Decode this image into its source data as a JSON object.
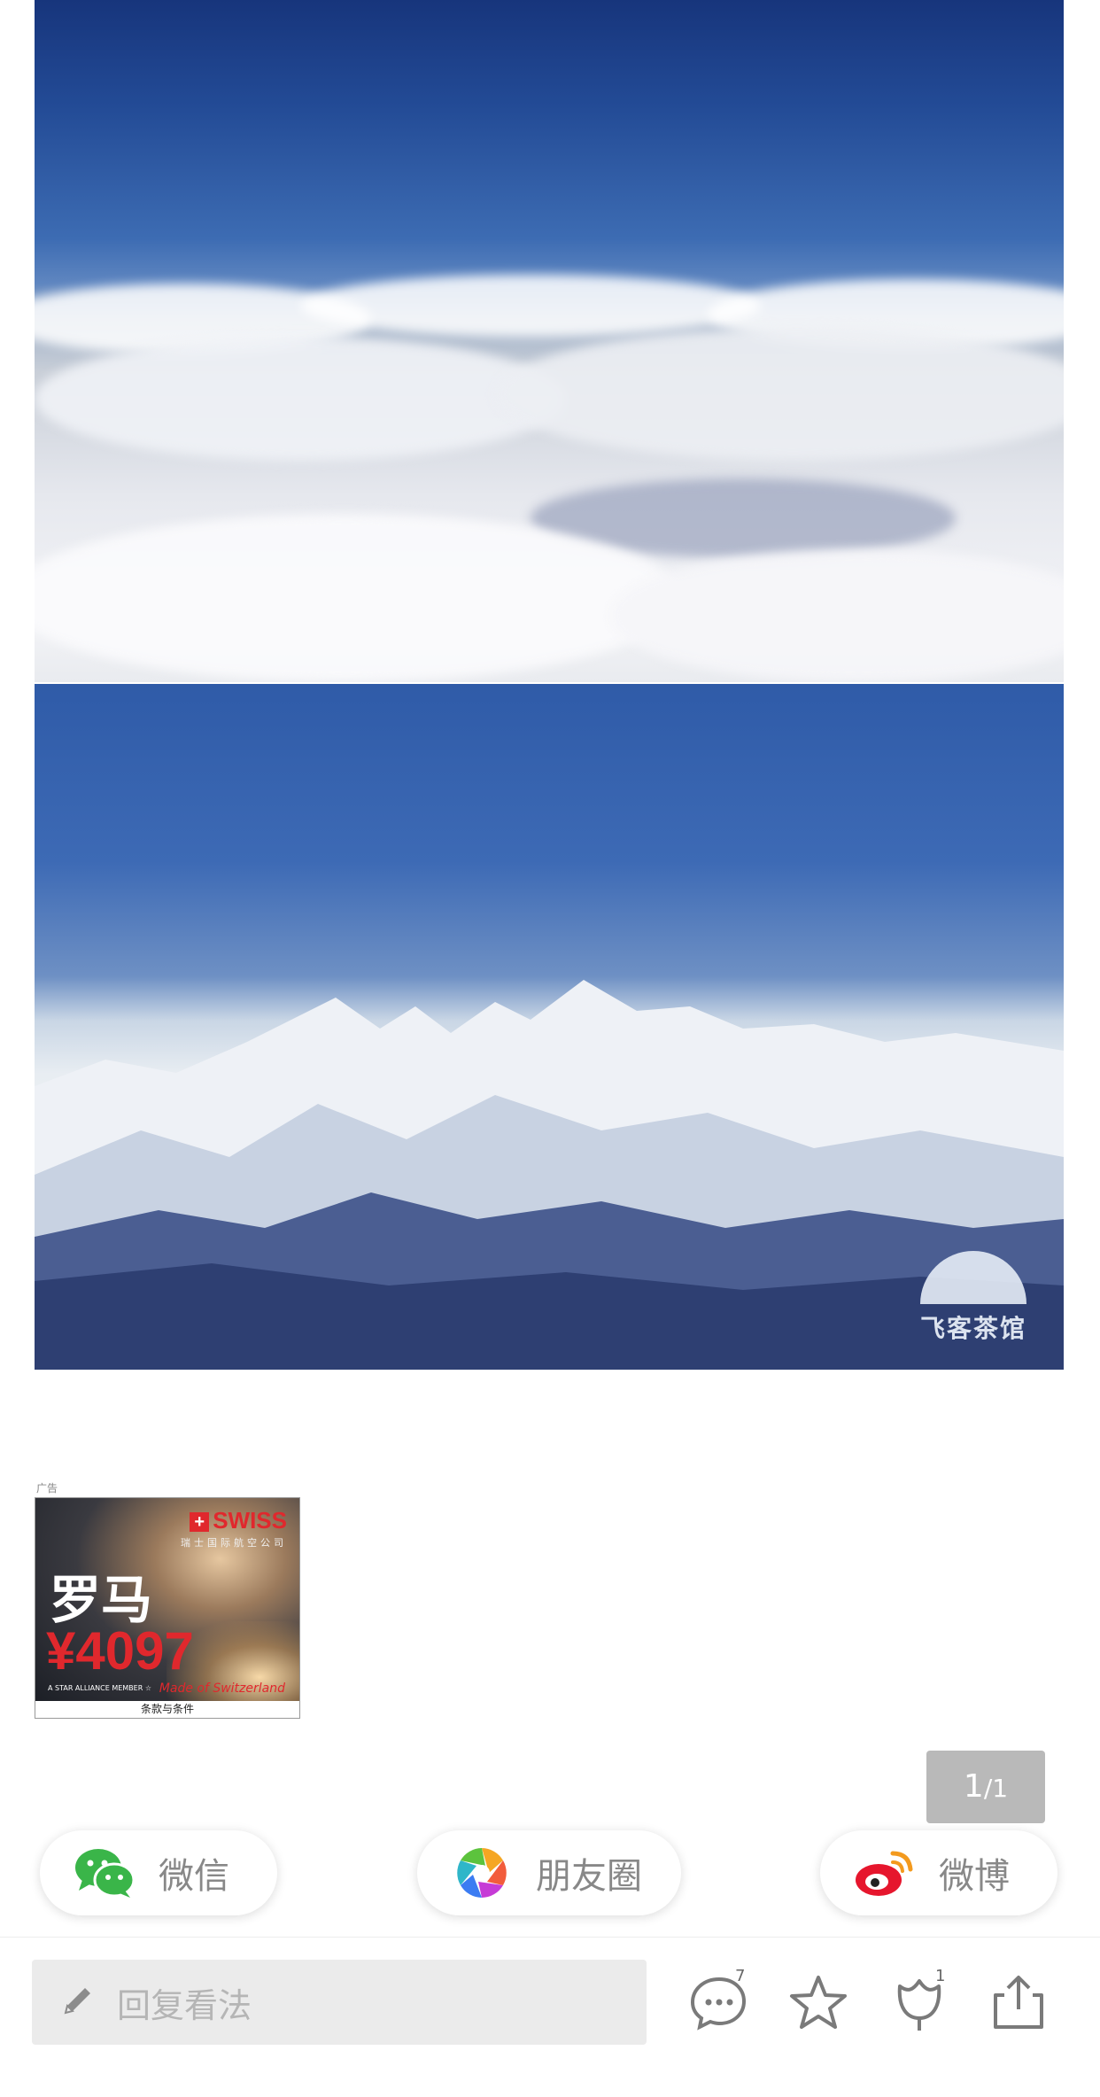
{
  "watermark": {
    "text": "飞客茶馆"
  },
  "ad": {
    "label": "广告",
    "brand": "SWISS",
    "brand_sub": "瑞士国际航空公司",
    "city": "罗马",
    "price": "¥4097",
    "alliance": "A STAR ALLIANCE MEMBER ☆",
    "tagline": "Made of Switzerland",
    "terms": "条款与条件"
  },
  "pager": {
    "current": "1",
    "separator": "/",
    "total": "1"
  },
  "share": {
    "wechat_label": "微信",
    "moments_label": "朋友圈",
    "weibo_label": "微博"
  },
  "bottom_bar": {
    "reply_placeholder": "回复看法",
    "comment_count": "7",
    "like_count": "1"
  },
  "colors": {
    "wechat_green": "#3ab549",
    "weibo_red": "#e6162d",
    "ad_red": "#e0282d",
    "icon_gray": "#7a7a7a"
  }
}
